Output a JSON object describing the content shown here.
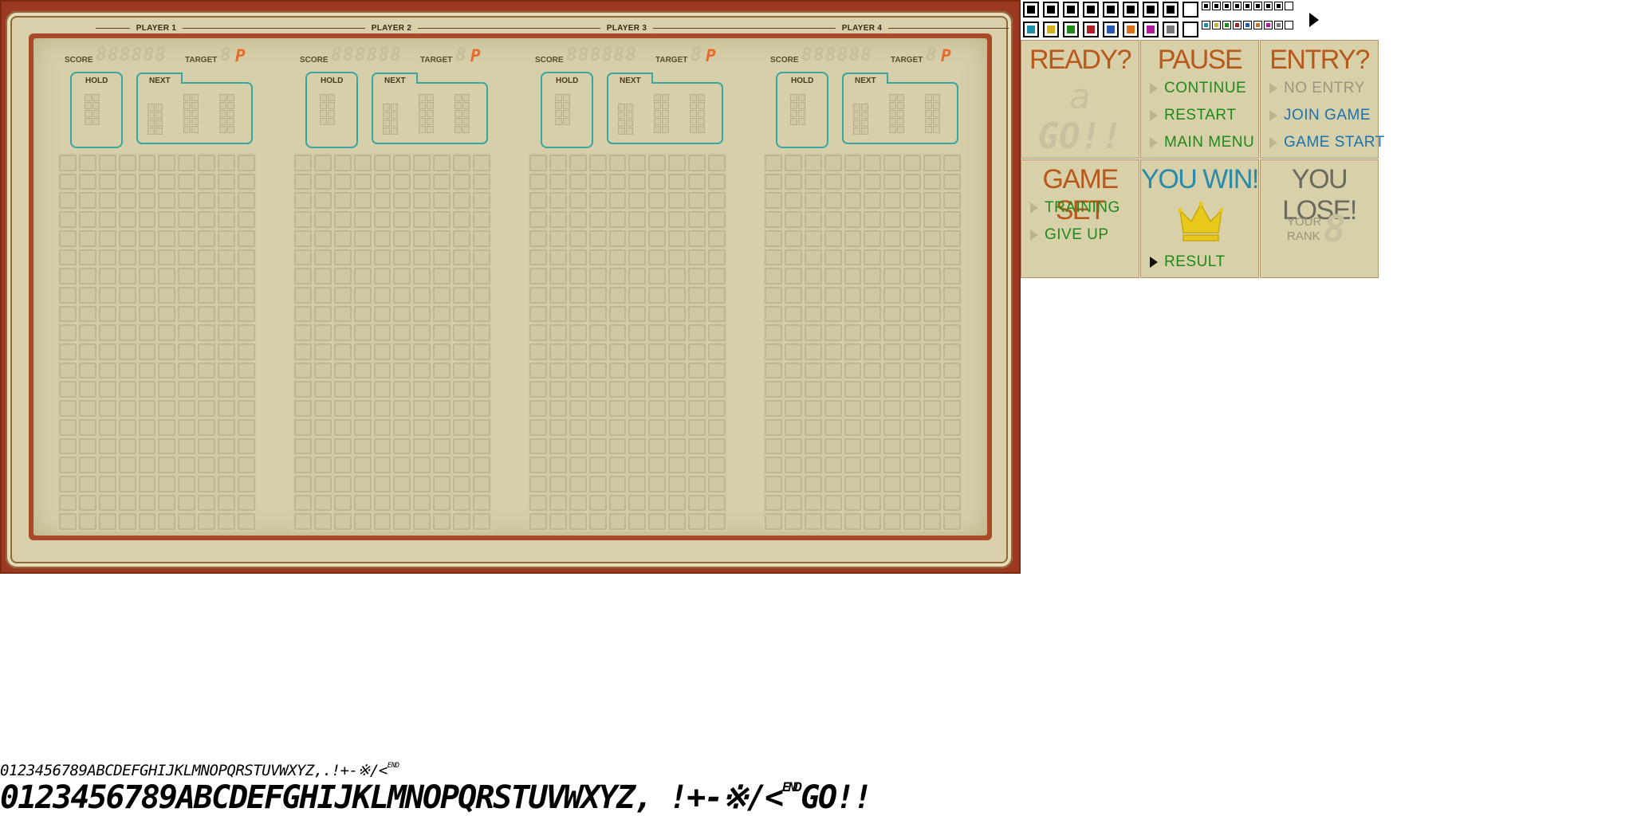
{
  "players": [
    {
      "title": "PLAYER 1"
    },
    {
      "title": "PLAYER 2"
    },
    {
      "title": "PLAYER 3"
    },
    {
      "title": "PLAYER 4"
    }
  ],
  "hud": {
    "score_label": "SCORE",
    "score_digits": "888888",
    "target_label": "TARGET",
    "target_digit": "8",
    "target_suffix": "P",
    "hold_label": "HOLD",
    "next_label": "NEXT"
  },
  "field": {
    "columns": 10,
    "rows": 20
  },
  "colors": {
    "frame": "#9b3a20",
    "panel_bg": "#d8d0a8",
    "accent_teal": "#3aa6a0",
    "target_orange": "#e86a2a",
    "title_orange": "#b8581a",
    "option_green": "#1f8a1a",
    "option_blue": "#1a72b0",
    "option_gray": "#9a9480",
    "win_blue": "#2a8aaa",
    "lose_gray": "#6a6a60",
    "crown_yellow": "#e8c81a"
  },
  "swatches": {
    "row1": [
      "#000000",
      "#000000",
      "#000000",
      "#000000",
      "#000000",
      "#000000",
      "#000000",
      "#000000",
      "#ffffff"
    ],
    "row2": [
      "#1f8fa8",
      "#d6b01a",
      "#1f8a1a",
      "#b0202a",
      "#2a5ab0",
      "#d8701a",
      "#b01a9a",
      "#7a7a7a",
      "#ffffff"
    ]
  },
  "panels": {
    "ready": {
      "title": "READY?",
      "line1": "a",
      "line2": "GO!!"
    },
    "pause": {
      "title": "PAUSE",
      "options": [
        "CONTINUE",
        "RESTART",
        "MAIN MENU"
      ]
    },
    "entry": {
      "title": "ENTRY?",
      "options": [
        "NO ENTRY",
        "JOIN GAME",
        "GAME START"
      ]
    },
    "gameset": {
      "title": "GAME SET",
      "options": [
        "TRAINING",
        "GIVE UP"
      ]
    },
    "youwin": {
      "title": "YOU WIN!",
      "option": "RESULT",
      "icon": "crown-icon"
    },
    "youlose": {
      "title": "YOU LOSE!",
      "rank_label_1": "YOUR",
      "rank_label_2": "RANK",
      "rank_digit": "8"
    }
  },
  "font_strips": {
    "small": "0123456789ABCDEFGHIJKLMNOPQRSTUVWXYZ,.!+-※/<",
    "small_end": "END",
    "large": "0123456789ABCDEFGHIJKLMNOPQRSTUVWXYZ, !+-※/<",
    "large_end": "END",
    "large_go": "GO!!"
  }
}
